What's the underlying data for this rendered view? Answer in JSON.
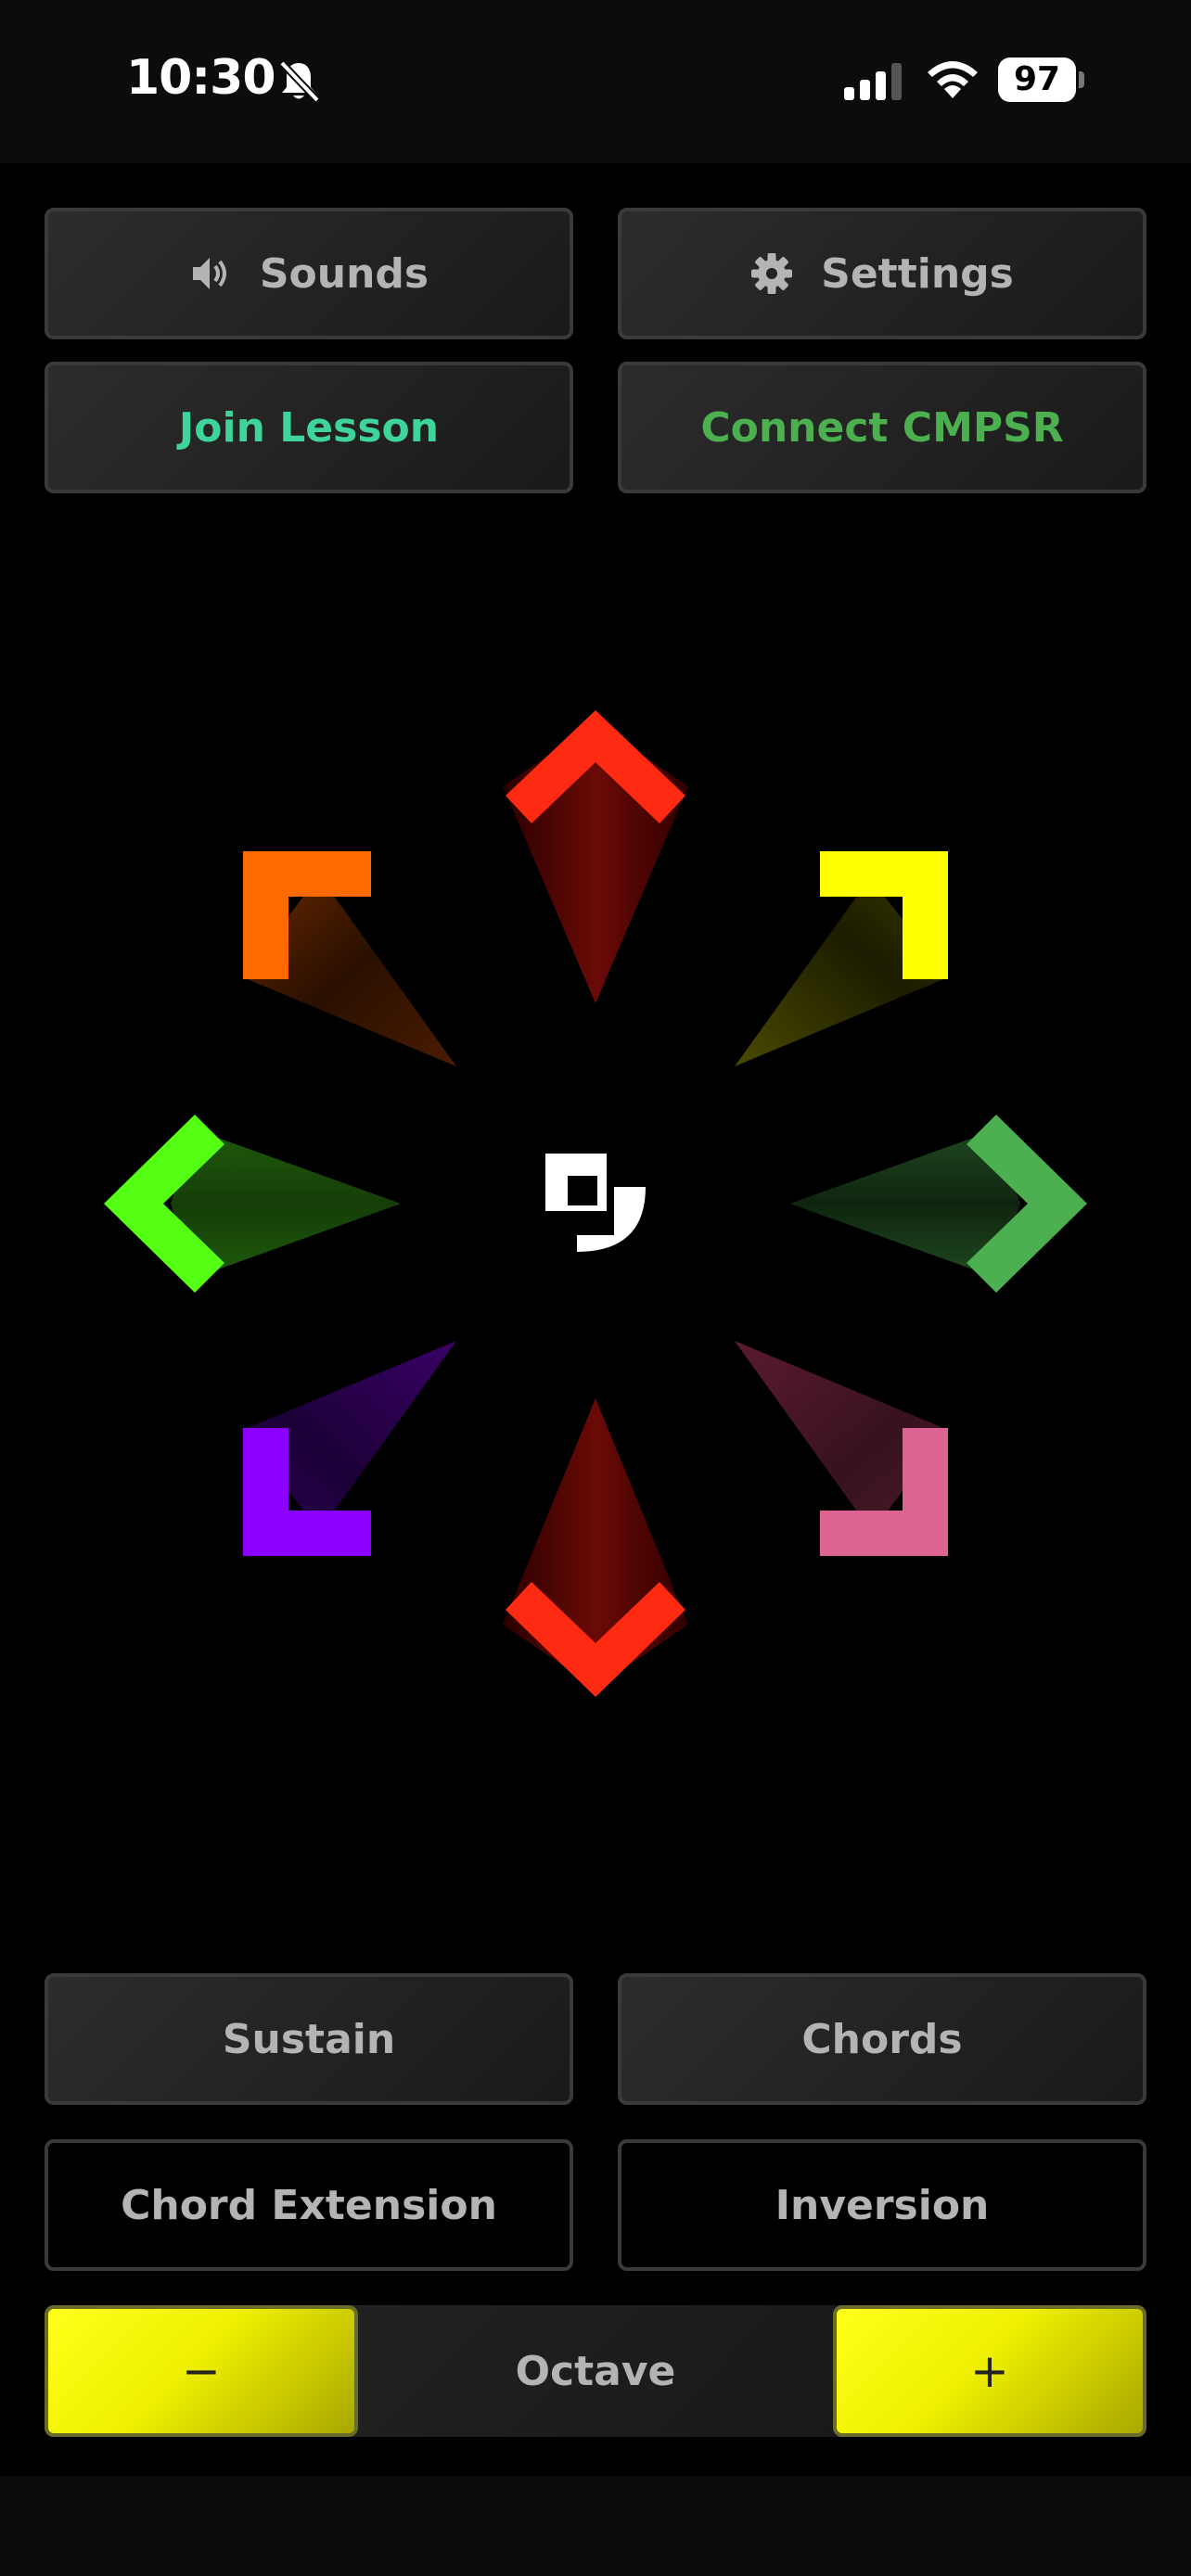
{
  "status_bar": {
    "time": "10:30",
    "battery": "97",
    "icons": [
      "bell-slash-icon",
      "cellular-signal-icon",
      "wifi-icon",
      "battery-icon"
    ]
  },
  "top_buttons": {
    "sounds": {
      "label": "Sounds",
      "icon": "speaker-icon"
    },
    "settings": {
      "label": "Settings",
      "icon": "gear-icon"
    },
    "join_lesson": {
      "label": "Join Lesson",
      "color": "#3fd49a"
    },
    "connect": {
      "label": "Connect CMPSR",
      "color": "#4caf50"
    }
  },
  "wheel": {
    "center_icon": "app-logo-icon",
    "directions": [
      {
        "name": "up",
        "color": "#ff2a12"
      },
      {
        "name": "up-right",
        "color": "#ffff00"
      },
      {
        "name": "right",
        "color": "#4caf50"
      },
      {
        "name": "down-right",
        "color": "#dd6392"
      },
      {
        "name": "down",
        "color": "#ff2a12"
      },
      {
        "name": "down-left",
        "color": "#8c00ff"
      },
      {
        "name": "left",
        "color": "#55ff14"
      },
      {
        "name": "up-left",
        "color": "#ff6a00"
      }
    ]
  },
  "bottom_buttons": {
    "sustain": "Sustain",
    "chords": "Chords",
    "chord_extension": "Chord Extension",
    "inversion": "Inversion"
  },
  "octave": {
    "label": "Octave",
    "minus": "−",
    "plus": "+",
    "accent": "#ffff00"
  }
}
